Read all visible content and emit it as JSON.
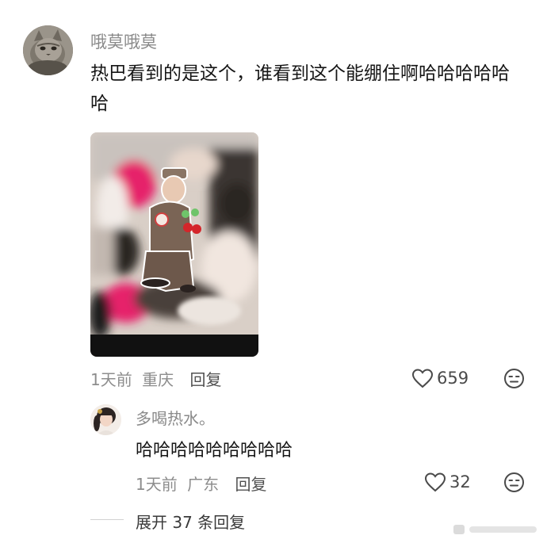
{
  "comment": {
    "username": "哦莫哦莫",
    "text": "热巴看到的是这个，谁看到这个能绷住啊哈哈哈哈哈哈",
    "time": "1天前",
    "location": "重庆",
    "reply_label": "回复",
    "likes": "659"
  },
  "reply": {
    "username": "多喝热水。",
    "text": "哈哈哈哈哈哈哈哈哈",
    "time": "1天前",
    "location": "广东",
    "reply_label": "回复",
    "likes": "32"
  },
  "expand": {
    "label": "展开 37 条回复"
  },
  "icons": {
    "like": "heart-outline-icon",
    "dislike": "neutral-face-icon"
  },
  "colors": {
    "text": "#161616",
    "muted": "#8a8a8a",
    "accent_pink": "#e6246a"
  }
}
